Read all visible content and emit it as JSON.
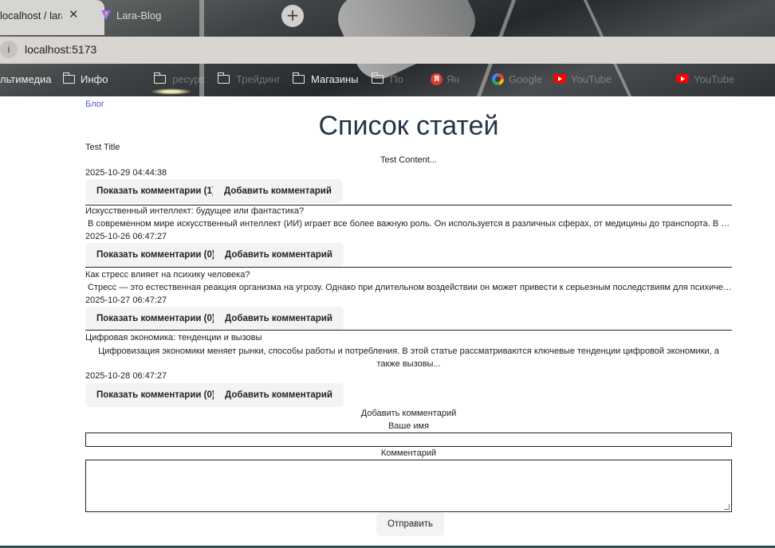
{
  "browser": {
    "tabs": [
      {
        "label": "localhost / lara"
      },
      {
        "label": "Lara-Blog"
      }
    ],
    "address": "localhost:5173",
    "bookmarks": [
      {
        "label": "льтимедиа"
      },
      {
        "label": "Инфо"
      },
      {
        "label": "ресурс"
      },
      {
        "label": "Трейдинг"
      },
      {
        "label": "Магазины"
      },
      {
        "label": "По"
      },
      {
        "label": "Ян"
      },
      {
        "label": "Google"
      },
      {
        "label": "YouTube"
      },
      {
        "label": "YouTube"
      }
    ]
  },
  "nav": {
    "blog_link": "Блог"
  },
  "page": {
    "title": "Список статей"
  },
  "articles": [
    {
      "title": "Test Title",
      "content": "Test Content...",
      "date": "2025-10-29 04:44:38",
      "show_comments": "Показать комментарии (1)",
      "add_comment": "Добавить комментарий"
    },
    {
      "title": "Искусственный интеллект: будущее или фантастика?",
      "content": "В современном мире искусственный интеллект (ИИ) играет все более важную роль. Он используется в различных сферах, от медицины до транспорта. В данной ...",
      "date": "2025-10-26 06:47:27",
      "show_comments": "Показать комментарии (0)",
      "add_comment": "Добавить комментарий"
    },
    {
      "title": "Как стресс влияет на психику человека?",
      "content": "Стресс — это естественная реакция организма на угрозу. Однако при длительном воздействии он может привести к серьезным последствиям для психического здоровья...",
      "date": "2025-10-27 06:47:27",
      "show_comments": "Показать комментарии (0)",
      "add_comment": "Добавить комментарий"
    },
    {
      "title": "Цифровая экономика: тенденции и вызовы",
      "content": "Цифровизация экономики меняет рынки, способы работы и потребления. В этой статье рассматриваются ключевые тенденции цифровой экономики, а также вызовы...",
      "date": "2025-10-28 06:47:27",
      "show_comments": "Показать комментарии (0)",
      "add_comment": "Добавить комментарий"
    }
  ],
  "comment_form": {
    "heading": "Добавить комментарий",
    "name_label": "Ваше имя",
    "name_value": "",
    "comment_label": "Комментарий",
    "comment_value": "",
    "submit": "Отправить"
  },
  "colors": {
    "link": "#4f5bd5",
    "title": "#233446",
    "button_bg": "#f3f3f3"
  }
}
